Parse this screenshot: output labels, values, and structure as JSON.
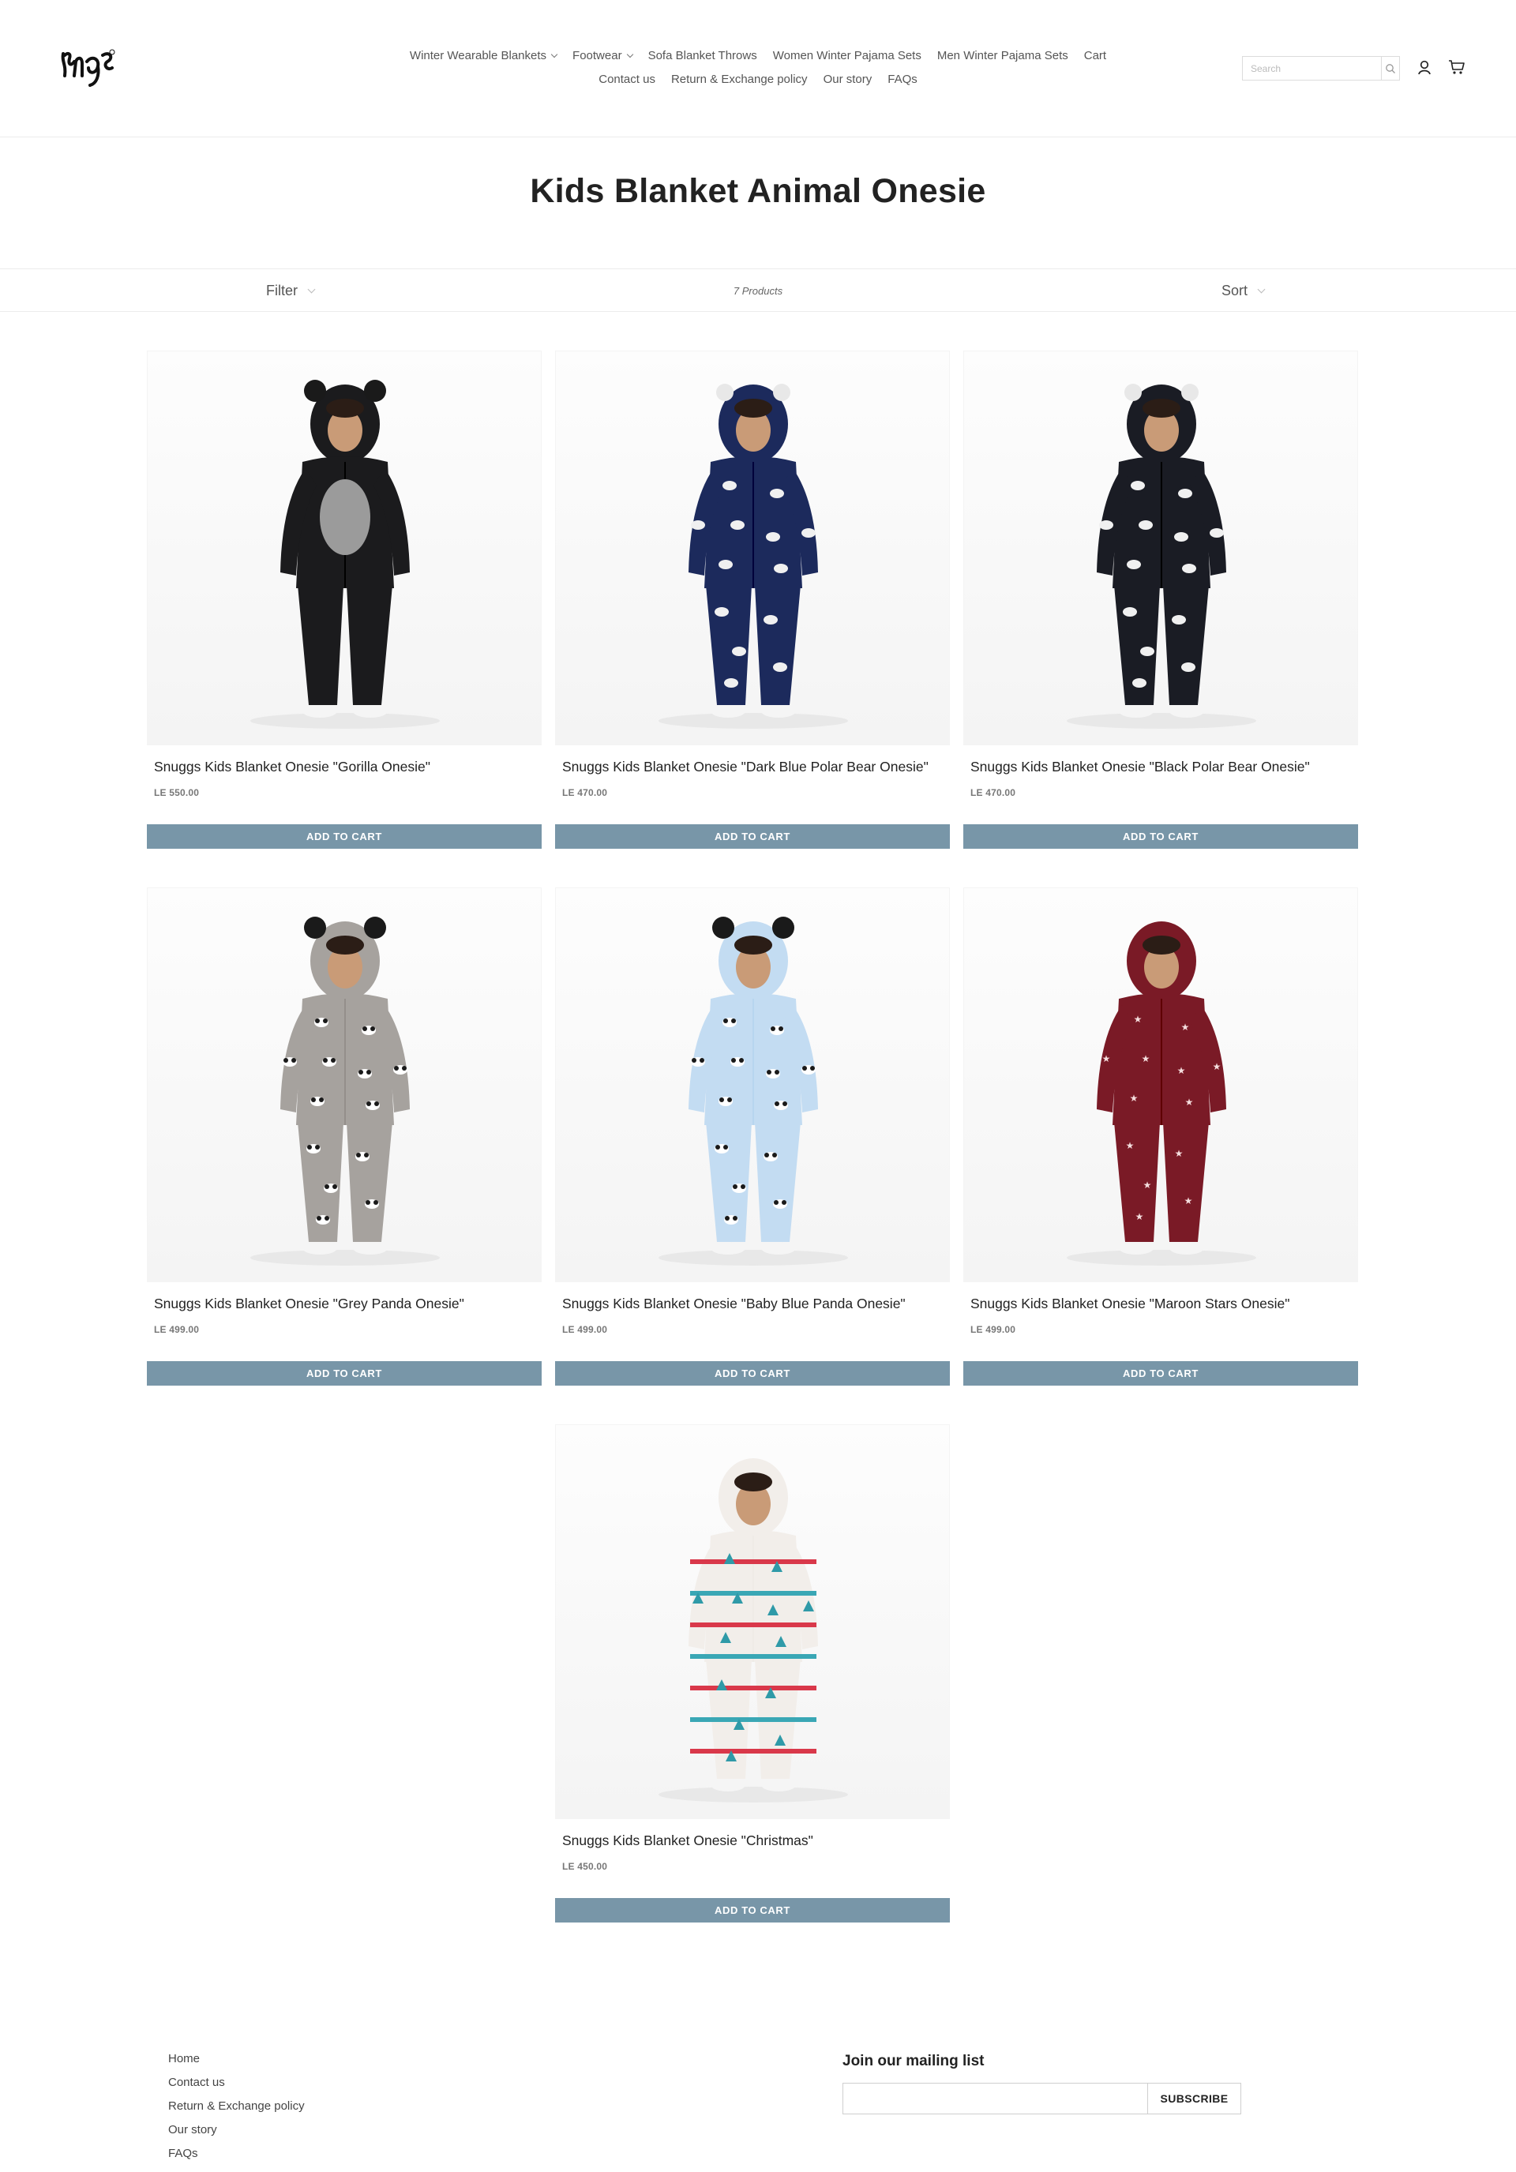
{
  "header": {
    "logo_text": "Snggs",
    "nav_row1": [
      {
        "label": "Winter Wearable Blankets",
        "has_dropdown": true
      },
      {
        "label": "Footwear",
        "has_dropdown": true
      },
      {
        "label": "Sofa Blanket Throws",
        "has_dropdown": false
      },
      {
        "label": "Women Winter Pajama Sets",
        "has_dropdown": false
      },
      {
        "label": "Men Winter Pajama Sets",
        "has_dropdown": false
      },
      {
        "label": "Cart",
        "has_dropdown": false
      }
    ],
    "nav_row2": [
      {
        "label": "Contact us"
      },
      {
        "label": "Return & Exchange policy"
      },
      {
        "label": "Our story"
      },
      {
        "label": "FAQs"
      }
    ],
    "search_placeholder": "Search",
    "icons": [
      "search-icon",
      "account-icon",
      "cart-icon"
    ]
  },
  "collection": {
    "title": "Kids Blanket Animal Onesie",
    "filter_label": "Filter",
    "product_count": "7 Products",
    "sort_label": "Sort"
  },
  "products": [
    {
      "name": "Snuggs Kids Blanket Onesie \"Gorilla Onesie\"",
      "price": "LE 550.00",
      "button": "ADD TO CART",
      "color": "#1b1b1d",
      "pattern": "gorilla"
    },
    {
      "name": "Snuggs Kids Blanket Onesie \"Dark Blue Polar Bear Onesie\"",
      "price": "LE 470.00",
      "button": "ADD TO CART",
      "color": "#1c2a5c",
      "pattern": "bears"
    },
    {
      "name": "Snuggs Kids Blanket Onesie \"Black Polar Bear Onesie\"",
      "price": "LE 470.00",
      "button": "ADD TO CART",
      "color": "#1a1c24",
      "pattern": "bears"
    },
    {
      "name": "Snuggs Kids Blanket Onesie \"Grey Panda Onesie\"",
      "price": "LE 499.00",
      "button": "ADD TO CART",
      "color": "#a6a29e",
      "pattern": "panda"
    },
    {
      "name": "Snuggs Kids Blanket Onesie \"Baby Blue Panda Onesie\"",
      "price": "LE 499.00",
      "button": "ADD TO CART",
      "color": "#c3dcf2",
      "pattern": "panda"
    },
    {
      "name": "Snuggs Kids Blanket Onesie \"Maroon Stars Onesie\"",
      "price": "LE 499.00",
      "button": "ADD TO CART",
      "color": "#7a1a26",
      "pattern": "stars"
    },
    {
      "name": "Snuggs Kids Blanket Onesie \"Christmas\"",
      "price": "LE 450.00",
      "button": "ADD TO CART",
      "color": "#f2eeea",
      "pattern": "christmas"
    }
  ],
  "footer": {
    "links": [
      "Home",
      "Contact us",
      "Return & Exchange policy",
      "Our story",
      "FAQs"
    ],
    "mailing_title": "Join our mailing list",
    "subscribe_label": "SUBSCRIBE"
  },
  "colors": {
    "button": "#7896a8",
    "text": "#222222",
    "border": "#ececec"
  }
}
